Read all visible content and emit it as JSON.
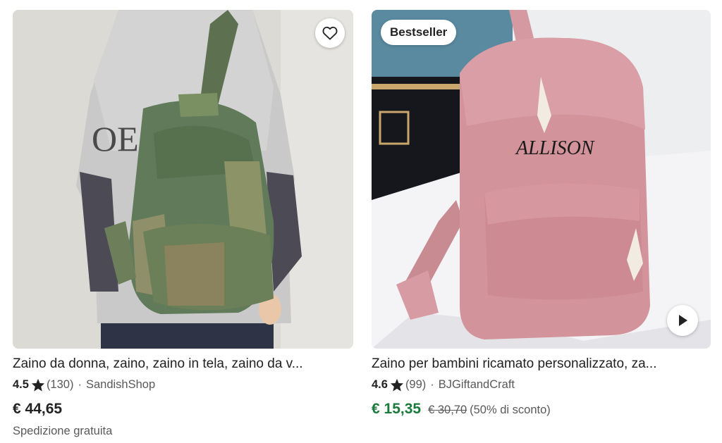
{
  "listings": [
    {
      "title": "Zaino da donna, zaino, zaino in tela, zaino da v...",
      "rating": "4.5",
      "reviews": "(130)",
      "separator": "·",
      "shop": "SandishShop",
      "price": "€ 44,65",
      "shipping": "Spedizione gratuita",
      "favorite_icon": "heart-outline-icon",
      "shirt_print": "OE I"
    },
    {
      "title": "Zaino per bambini ricamato personalizzato, za...",
      "rating": "4.6",
      "reviews": "(99)",
      "separator": "·",
      "shop": "BJGiftandCraft",
      "price": "€ 15,35",
      "old_price": "€ 30,70",
      "discount": "(50% di sconto)",
      "badge": "Bestseller",
      "embroidery": "ALLISON",
      "video_icon": "play-icon",
      "price_color": "#1a7a3c"
    }
  ]
}
